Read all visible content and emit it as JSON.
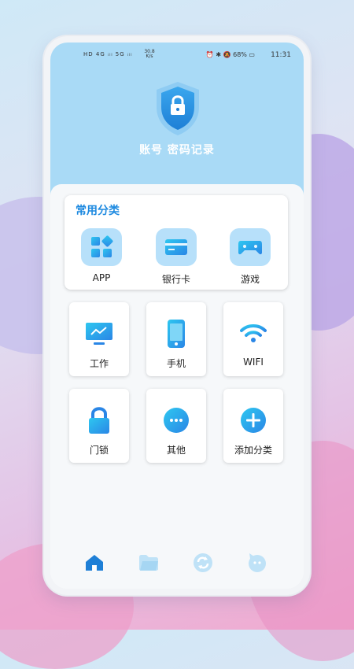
{
  "status_bar": {
    "left": "HD 4G ᵢₗₗ 5G ᵢₗₗ",
    "speed": "30.8 K/s",
    "battery": "68%",
    "time": "11:31"
  },
  "header": {
    "title": "账号 密码记录"
  },
  "common_category": {
    "title": "常用分类",
    "items": [
      {
        "label": "APP",
        "icon": "app-grid-icon"
      },
      {
        "label": "银行卡",
        "icon": "bank-card-icon"
      },
      {
        "label": "游戏",
        "icon": "gamepad-icon"
      }
    ]
  },
  "categories": [
    {
      "label": "工作",
      "icon": "work-monitor-icon"
    },
    {
      "label": "手机",
      "icon": "phone-icon"
    },
    {
      "label": "WIFI",
      "icon": "wifi-icon"
    },
    {
      "label": "门锁",
      "icon": "lock-icon"
    },
    {
      "label": "其他",
      "icon": "more-icon"
    },
    {
      "label": "添加分类",
      "icon": "add-icon"
    }
  ],
  "bottom_nav": [
    {
      "name": "home",
      "icon": "home-icon",
      "active": true
    },
    {
      "name": "folder",
      "icon": "folder-icon",
      "active": false
    },
    {
      "name": "sync",
      "icon": "sync-icon",
      "active": false
    },
    {
      "name": "profile",
      "icon": "profile-icon",
      "active": false
    }
  ],
  "colors": {
    "accent": "#1e8ae0",
    "header_bg": "#a9daf6",
    "icon_bg": "#b7e0fa",
    "gradient_start": "#2ec7f0",
    "gradient_end": "#2a86e6"
  }
}
